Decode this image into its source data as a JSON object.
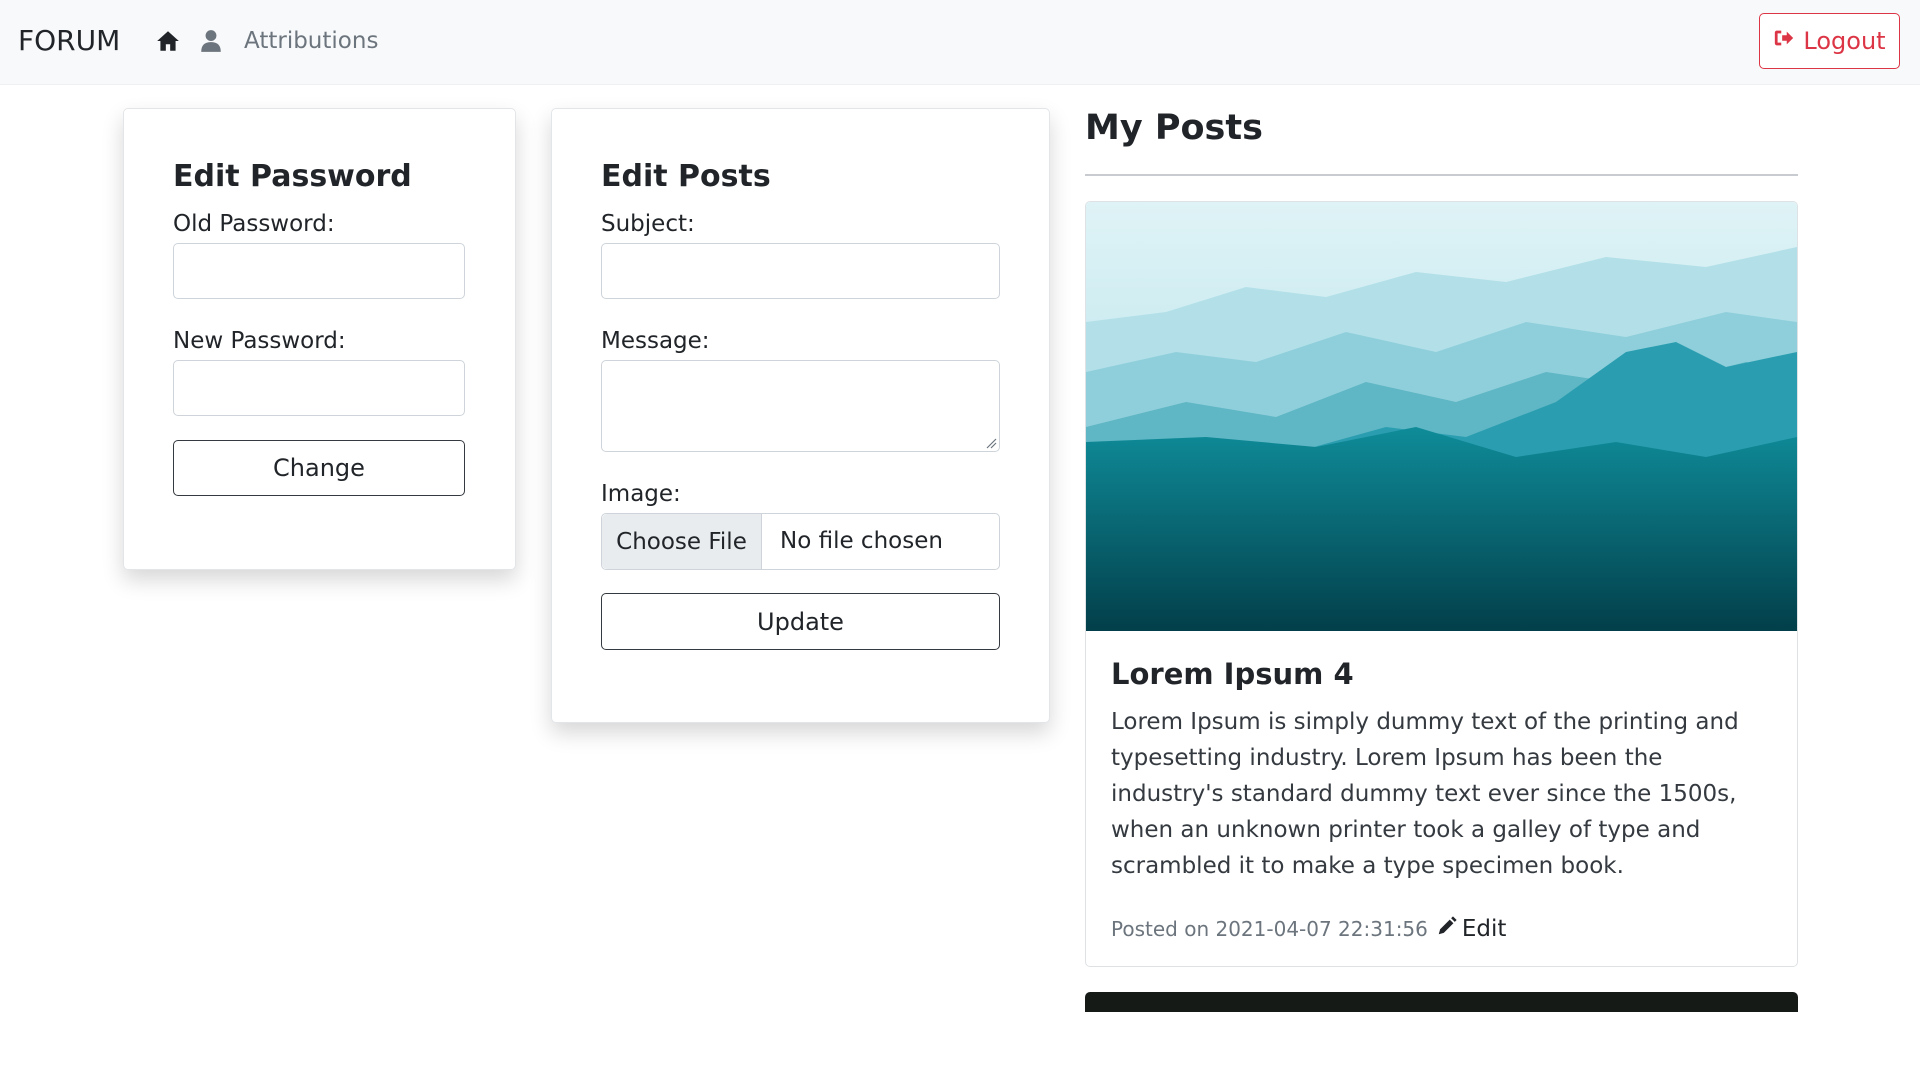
{
  "nav": {
    "brand": "FORUM",
    "home_icon": "home-icon",
    "user_icon": "user-icon",
    "attributions": "Attributions",
    "logout_label": "Logout",
    "logout_icon": "sign-out-icon",
    "danger_color": "#dc3545"
  },
  "password_card": {
    "title": "Edit Password",
    "old_label": "Old Password:",
    "old_value": "",
    "new_label": "New Password:",
    "new_value": "",
    "button_label": "Change"
  },
  "posts_card": {
    "title": "Edit Posts",
    "subject_label": "Subject:",
    "subject_value": "",
    "message_label": "Message:",
    "message_value": "",
    "image_label": "Image:",
    "choose_file_label": "Choose File",
    "file_status": "No file chosen",
    "button_label": "Update"
  },
  "my_posts": {
    "heading": "My Posts",
    "posts": [
      {
        "title": "Lorem Ipsum 4",
        "body": "Lorem Ipsum is simply dummy text of the printing and typesetting industry. Lorem Ipsum has been the industry's standard dummy text ever since the 1500s, when an unknown printer took a galley of type and scrambled it to make a type specimen book.",
        "posted_on": "Posted on 2021-04-07 22:31:56",
        "edit_label": "Edit",
        "edit_icon": "pencil-icon",
        "image_icon": "mountain-landscape-image"
      }
    ]
  }
}
